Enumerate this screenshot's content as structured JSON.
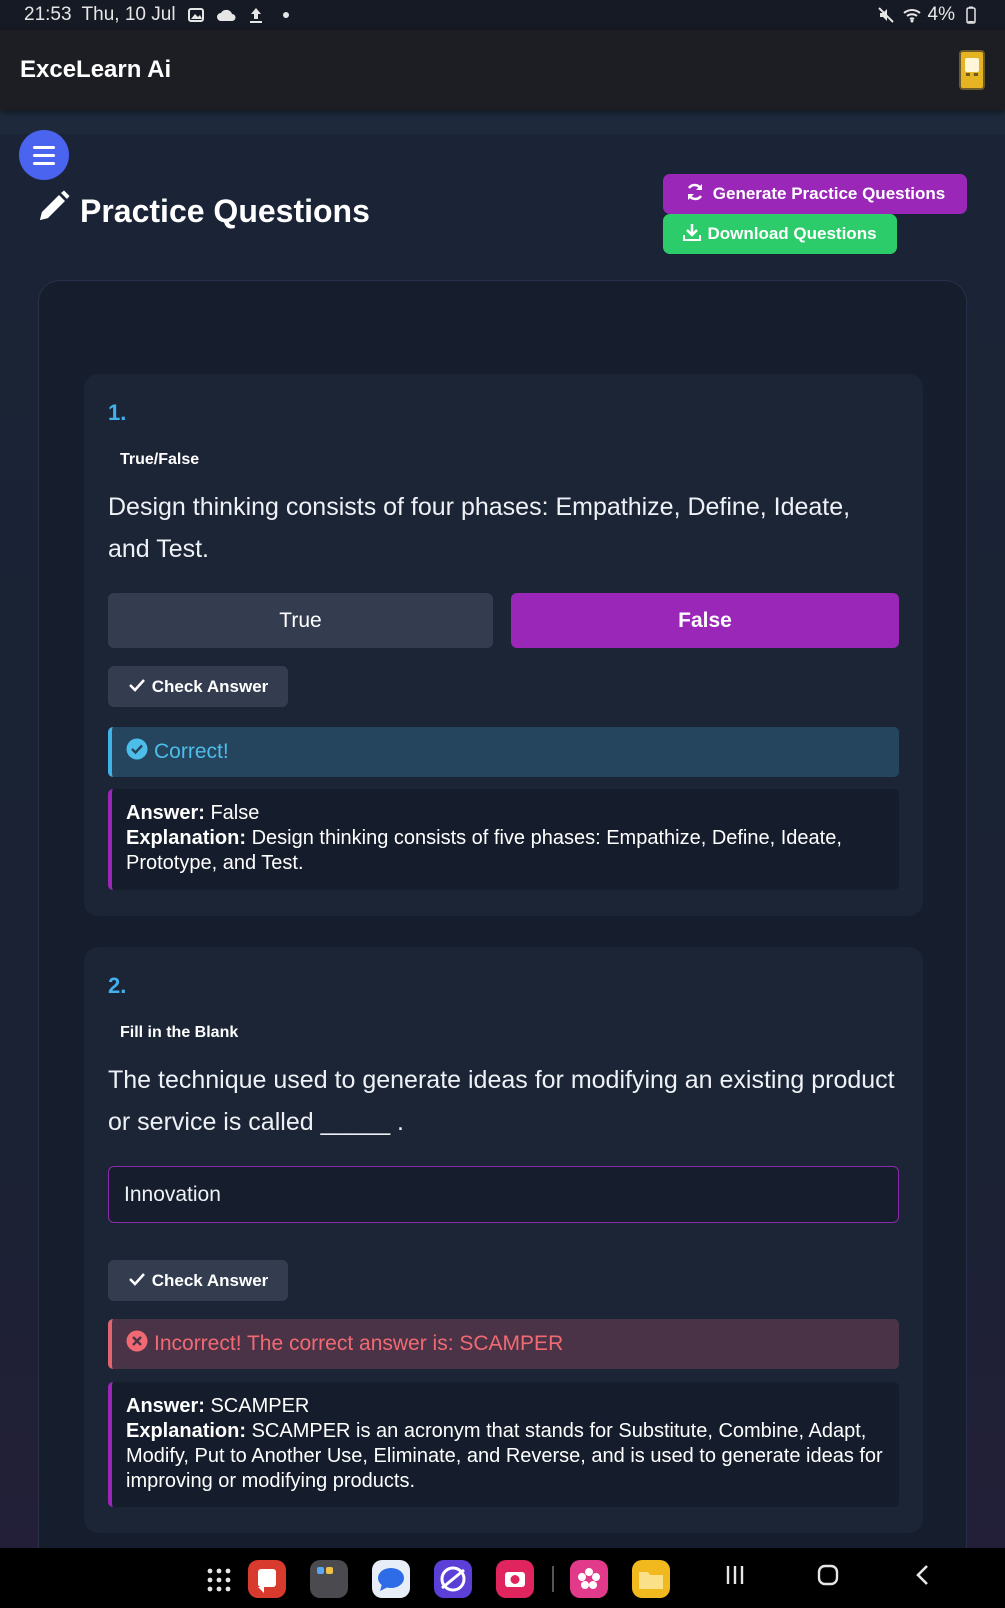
{
  "status_bar": {
    "time": "21:53",
    "date": "Thu, 10 Jul",
    "battery": "4%",
    "icons_left": [
      "image-icon",
      "cloud-icon",
      "upload-icon",
      "dot-icon"
    ],
    "icons_right": [
      "mute-icon",
      "wifi-icon",
      "battery-icon"
    ]
  },
  "app_bar": {
    "title": "ExceLearn Ai"
  },
  "page": {
    "title": "Practice Questions",
    "generate_button": "Generate Practice Questions",
    "download_button": "Download Questions"
  },
  "questions": [
    {
      "number": "1.",
      "type": "True/False",
      "text": "Design thinking consists of four phases: Empathize, Define, Ideate, and Test.",
      "options": [
        "True",
        "False"
      ],
      "selected": "False",
      "check_label": "Check Answer",
      "feedback": "Correct!",
      "answer_label": "Answer:",
      "answer": "False",
      "explanation_label": "Explanation:",
      "explanation": "Design thinking consists of five phases: Empathize, Define, Ideate, Prototype, and Test."
    },
    {
      "number": "2.",
      "type": "Fill in the Blank",
      "text": "The technique used to generate ideas for modifying an existing product or service is called _____ .",
      "input_value": "Innovation",
      "check_label": "Check Answer",
      "feedback": "Incorrect! The correct answer is: SCAMPER",
      "answer_label": "Answer:",
      "answer": "SCAMPER",
      "explanation_label": "Explanation:",
      "explanation": "SCAMPER is an acronym that stands for Substitute, Combine, Adapt, Modify, Put to Another Use, Eliminate, and Reverse, and is used to generate ideas for improving or modifying products."
    }
  ],
  "colors": {
    "accent_purple": "#9b27b8",
    "accent_green": "#2dcc6a",
    "menu_blue": "#4a64f0",
    "number_blue": "#42b0ec",
    "correct": "#4dbde9",
    "incorrect": "#f16a73"
  },
  "nav_bar": {
    "dock_apps": [
      "apps-grid-icon",
      "slides-app-icon",
      "folder-app-icon",
      "messages-app-icon",
      "browser-app-icon",
      "camera-app-icon",
      "flower-app-icon",
      "files-app-icon"
    ],
    "system": [
      "recents-icon",
      "home-icon",
      "back-icon"
    ]
  }
}
